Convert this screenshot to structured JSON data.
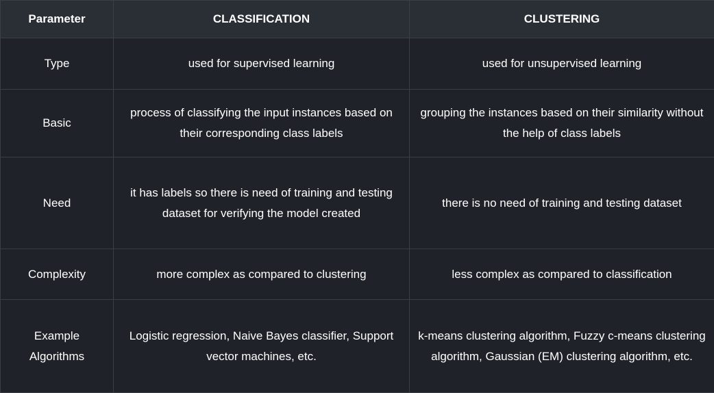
{
  "table": {
    "headers": [
      "Parameter",
      "CLASSIFICATION",
      "CLUSTERING"
    ],
    "rows": [
      {
        "parameter": "Type",
        "classification": "used for supervised learning",
        "clustering": "used for unsupervised learning"
      },
      {
        "parameter": "Basic",
        "classification": "process of classifying the input instances based on their corresponding class labels",
        "clustering": "grouping the instances based on their similarity without the help of class labels"
      },
      {
        "parameter": "Need",
        "classification": "it has labels so there is need of training and testing dataset for verifying the model created",
        "clustering": "there is no need of training and testing dataset"
      },
      {
        "parameter": "Complexity",
        "classification": "more complex as compared to clustering",
        "clustering": "less complex as compared to classification"
      },
      {
        "parameter": "Example Algorithms",
        "classification": "Logistic regression, Naive Bayes classifier, Support vector machines, etc.",
        "clustering": "k-means clustering algorithm, Fuzzy c-means clustering algorithm, Gaussian (EM) clustering algorithm, etc."
      }
    ]
  },
  "colors": {
    "page_background": "#161a20",
    "header_background": "#2a2e35",
    "cell_background": "#1f2228",
    "border": "#3a3e45",
    "text": "#ffffff"
  }
}
